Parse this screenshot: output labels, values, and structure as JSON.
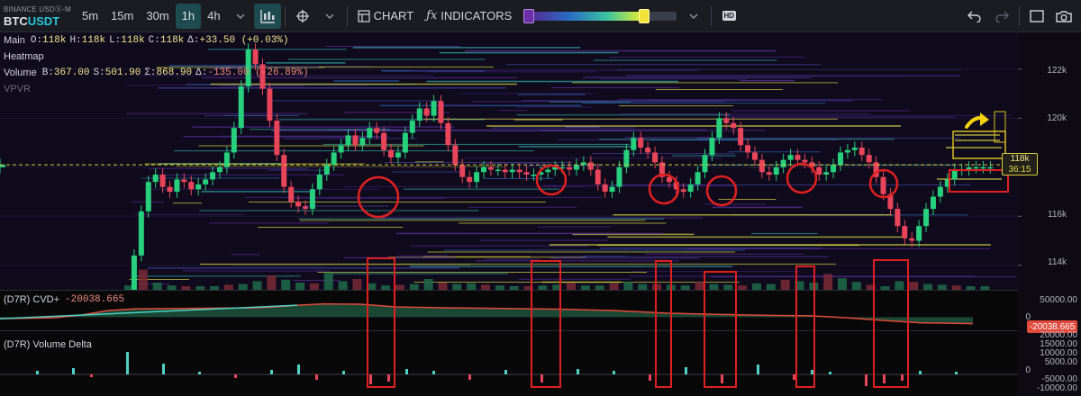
{
  "toolbar": {
    "exchange": "BINANCE USDⓈ-M",
    "symbol_base": "BTC",
    "symbol_quote": "USDT",
    "timeframes": [
      "5m",
      "15m",
      "30m",
      "1h",
      "4h"
    ],
    "active_timeframe": "1h",
    "chart_label": "CHART",
    "indicators_label": "INDICATORS",
    "hd_label": "HD",
    "heatmap_range": [
      0.0,
      0.78
    ]
  },
  "legend": {
    "main_label": "Main",
    "ohlc": {
      "o_key": "O:",
      "o": "118k",
      "h_key": "H:",
      "h": "118k",
      "l_key": "L:",
      "l": "118k",
      "c_key": "C:",
      "c": "118k",
      "d_key": "Δ:",
      "d": "+33.50 (+0.03%)"
    },
    "heatmap_label": "Heatmap",
    "volume_label": "Volume",
    "volume": {
      "b_key": "B:",
      "b": "367.00",
      "s_key": "S:",
      "s": "501.90",
      "sum_key": "Σ:",
      "sum": "868.90",
      "d_key": "Δ:",
      "d": "-135.00 (-26.89%)"
    },
    "vpvr_label": "VPVR"
  },
  "price_axis": {
    "ticks": [
      "122k",
      "120k",
      "118k",
      "116k",
      "114k"
    ],
    "current_price": "118k",
    "countdown": "36:15"
  },
  "cvd_panel": {
    "label": "(D7R) CVD+",
    "value": "-20038.665",
    "ticks": [
      "50000.00",
      "0"
    ],
    "tag": "-20038.665"
  },
  "vd_panel": {
    "label": "(D7R) Volume Delta",
    "ticks": [
      "20000.00",
      "15000.00",
      "10000.00",
      "5000.00",
      "0",
      "-5000.00",
      "-10000.00"
    ]
  },
  "colors": {
    "bull": "#26d07c",
    "bear": "#e8455a",
    "annotation": "#e02020",
    "arrow": "#f5d20a",
    "price_line": "#d9cc3a",
    "cvd": "#e04a3a",
    "cvd_pos": "#4fd1c5"
  },
  "chart_data": [
    {
      "type": "line",
      "title": "BTCUSDT",
      "ylabel": "",
      "ylim": [
        113000,
        123500
      ],
      "x": [
        0,
        8,
        16,
        24,
        32,
        40,
        48,
        56,
        64,
        72,
        80,
        88,
        96,
        104,
        112,
        120,
        128,
        136,
        144,
        152,
        160,
        168,
        176,
        184,
        192,
        200,
        208,
        216,
        224,
        232,
        240,
        248,
        256,
        264,
        272,
        280,
        288,
        296,
        304,
        312,
        320,
        328,
        336,
        344,
        352,
        360,
        368,
        376,
        384,
        392,
        400,
        408,
        416,
        424,
        432,
        440,
        448,
        456,
        464,
        472,
        480,
        488,
        496,
        504,
        512,
        520,
        528,
        536,
        544,
        552,
        560,
        568,
        576,
        584,
        592,
        600,
        608,
        616,
        624,
        632,
        640,
        648,
        656,
        664,
        672,
        680,
        688,
        696,
        704,
        712,
        720,
        728,
        736,
        744,
        752,
        760,
        768,
        776,
        784,
        792,
        800,
        808,
        816,
        824,
        832,
        840,
        848,
        856,
        864,
        872,
        880,
        888,
        896,
        904,
        912,
        920,
        928,
        936,
        944,
        952,
        960,
        968
      ],
      "values": [
        113000,
        114400,
        116200,
        117400,
        117700,
        117200,
        117000,
        117500,
        117400,
        117100,
        117300,
        117500,
        117800,
        118000,
        118600,
        119600,
        121300,
        122800,
        122200,
        121200,
        119900,
        118500,
        117200,
        116600,
        116400,
        116300,
        117100,
        117700,
        118100,
        118600,
        118900,
        119300,
        118900,
        119200,
        119600,
        119400,
        118700,
        118400,
        118600,
        119400,
        119900,
        120400,
        120100,
        120700,
        119800,
        118900,
        118100,
        117600,
        117400,
        117800,
        118000,
        117900,
        117900,
        117800,
        117900,
        117800,
        117700,
        117700,
        117800,
        117900,
        118000,
        118000,
        117900,
        118100,
        118200,
        117900,
        117300,
        117000,
        117200,
        118000,
        118700,
        119200,
        118800,
        118600,
        118200,
        117600,
        117400,
        117100,
        117000,
        117300,
        117800,
        118500,
        119200,
        120000,
        119800,
        119600,
        118900,
        118600,
        118300,
        117800,
        117700,
        118000,
        118300,
        118500,
        118300,
        118200,
        118000,
        117700,
        117800,
        118100,
        118600,
        118700,
        118800,
        118500,
        118200,
        117600,
        116900,
        116300,
        115600,
        115100,
        115000,
        115600,
        116300,
        116800,
        117200,
        117500,
        117900,
        117900,
        118000,
        118000,
        118000,
        118000,
        118100
      ]
    },
    {
      "type": "area",
      "title": "(D7R) CVD+",
      "ylim": [
        -40000,
        80000
      ],
      "x": [
        0,
        60,
        90,
        120,
        150,
        200,
        240,
        280,
        300,
        330,
        360,
        400,
        440,
        500,
        560,
        620,
        680,
        740,
        800,
        860,
        900,
        940,
        980,
        1020,
        1060,
        1080
      ],
      "values": [
        -5000,
        -2000,
        6000,
        20000,
        25000,
        26000,
        27000,
        28000,
        30000,
        36000,
        40000,
        39000,
        31000,
        28000,
        26000,
        24000,
        20000,
        12000,
        8000,
        5000,
        4000,
        -2000,
        -10000,
        -17000,
        -19000,
        -20038.665
      ]
    },
    {
      "type": "bar",
      "title": "(D7R) Volume Delta",
      "ylim": [
        -12000,
        24000
      ],
      "x": [
        40,
        80,
        100,
        140,
        180,
        220,
        260,
        300,
        330,
        350,
        380,
        410,
        430,
        450,
        480,
        520,
        560,
        600,
        640,
        680,
        720,
        760,
        800,
        840,
        880,
        900,
        920,
        960,
        980,
        1000,
        1020,
        1060
      ],
      "values": [
        2000,
        3500,
        -1500,
        12500,
        6000,
        1500,
        -2000,
        2500,
        5500,
        -3000,
        2000,
        -5500,
        -4000,
        3000,
        2000,
        -3000,
        2500,
        -4500,
        3000,
        2000,
        -3500,
        4000,
        -5000,
        5500,
        -3000,
        2500,
        1500,
        -6500,
        -5000,
        -3500,
        2000,
        1500
      ]
    },
    {
      "type": "bar",
      "title": "Volume",
      "ylim": [
        0,
        50
      ],
      "x": [
        0,
        16,
        32,
        48,
        64,
        80,
        96,
        112,
        128,
        144,
        160,
        176,
        192,
        208,
        224,
        240,
        256,
        272,
        288,
        304,
        320,
        336,
        352,
        368,
        384,
        400,
        416,
        432,
        448,
        464,
        480,
        496,
        512,
        528,
        544,
        560,
        576,
        592,
        608,
        624,
        640,
        656,
        672,
        688,
        704,
        720,
        736,
        752,
        768,
        784,
        800,
        816,
        832,
        848,
        864,
        880,
        896,
        912,
        928,
        944,
        960
      ],
      "values": [
        6,
        28,
        10,
        6,
        5,
        5,
        5,
        7,
        8,
        12,
        20,
        14,
        10,
        9,
        24,
        12,
        15,
        9,
        6,
        7,
        8,
        15,
        10,
        8,
        9,
        7,
        6,
        5,
        5,
        6,
        7,
        10,
        6,
        6,
        9,
        11,
        8,
        8,
        7,
        6,
        11,
        8,
        7,
        6,
        9,
        8,
        14,
        12,
        10,
        22,
        16,
        11,
        7,
        5,
        12,
        11,
        8,
        7,
        6,
        5,
        5
      ]
    }
  ]
}
